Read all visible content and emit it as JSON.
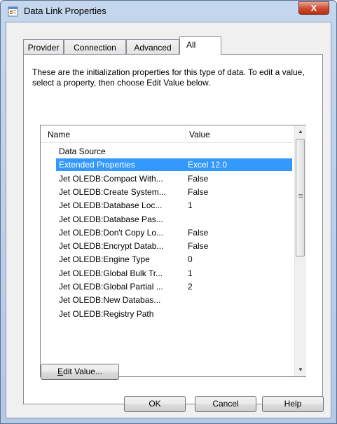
{
  "window": {
    "title": "Data Link Properties",
    "close_glyph": "X"
  },
  "tabs": [
    {
      "label": "Provider",
      "active": false
    },
    {
      "label": "Connection",
      "active": false
    },
    {
      "label": "Advanced",
      "active": false
    },
    {
      "label": "All",
      "active": true
    }
  ],
  "panel": {
    "description": "These are the initialization properties for this type of data. To edit a value, select a property, then choose Edit Value below."
  },
  "list": {
    "columns": {
      "name": "Name",
      "value": "Value"
    },
    "rows": [
      {
        "name": "Data Source",
        "value": ""
      },
      {
        "name": "Extended Properties",
        "value": "Excel 12.0",
        "selected": true
      },
      {
        "name": "Jet OLEDB:Compact With...",
        "value": "False"
      },
      {
        "name": "Jet OLEDB:Create System...",
        "value": "False"
      },
      {
        "name": "Jet OLEDB:Database Loc...",
        "value": "1"
      },
      {
        "name": "Jet OLEDB:Database Pas...",
        "value": ""
      },
      {
        "name": "Jet OLEDB:Don't Copy Lo...",
        "value": "False"
      },
      {
        "name": "Jet OLEDB:Encrypt Datab...",
        "value": "False"
      },
      {
        "name": "Jet OLEDB:Engine Type",
        "value": "0"
      },
      {
        "name": "Jet OLEDB:Global Bulk Tr...",
        "value": "1"
      },
      {
        "name": "Jet OLEDB:Global Partial ...",
        "value": "2"
      },
      {
        "name": "Jet OLEDB:New Databas...",
        "value": ""
      },
      {
        "name": "Jet OLEDB:Registry Path",
        "value": ""
      }
    ]
  },
  "buttons": {
    "edit_value_mnemonic": "E",
    "edit_value_rest": "dit Value...",
    "ok": "OK",
    "cancel": "Cancel",
    "help": "Help"
  }
}
